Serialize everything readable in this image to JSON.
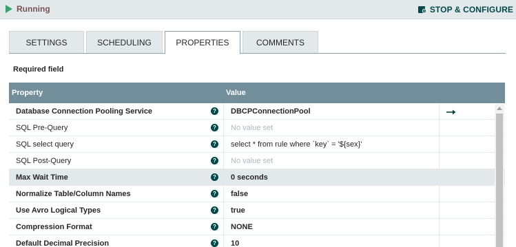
{
  "status": {
    "label": "Running",
    "color": "#3aa06e"
  },
  "header": {
    "stop_configure_label": "STOP & CONFIGURE"
  },
  "tabs": [
    {
      "label": "SETTINGS",
      "active": false
    },
    {
      "label": "SCHEDULING",
      "active": false
    },
    {
      "label": "PROPERTIES",
      "active": true
    },
    {
      "label": "COMMENTS",
      "active": false
    }
  ],
  "required_label": "Required field",
  "table": {
    "columns": {
      "property": "Property",
      "value": "Value"
    },
    "rows": [
      {
        "name": "Database Connection Pooling Service",
        "value": "DBCPConnectionPool",
        "required": true,
        "empty": false,
        "has_goto": true,
        "shaded": false
      },
      {
        "name": "SQL Pre-Query",
        "value": "No value set",
        "required": false,
        "empty": true,
        "has_goto": false,
        "shaded": false
      },
      {
        "name": "SQL select query",
        "value": "select * from rule where `key` = '${sex}'",
        "required": false,
        "empty": false,
        "has_goto": false,
        "shaded": false
      },
      {
        "name": "SQL Post-Query",
        "value": "No value set",
        "required": false,
        "empty": true,
        "has_goto": false,
        "shaded": false
      },
      {
        "name": "Max Wait Time",
        "value": "0 seconds",
        "required": true,
        "empty": false,
        "has_goto": false,
        "shaded": true
      },
      {
        "name": "Normalize Table/Column Names",
        "value": "false",
        "required": true,
        "empty": false,
        "has_goto": false,
        "shaded": false
      },
      {
        "name": "Use Avro Logical Types",
        "value": "true",
        "required": true,
        "empty": false,
        "has_goto": false,
        "shaded": false
      },
      {
        "name": "Compression Format",
        "value": "NONE",
        "required": true,
        "empty": false,
        "has_goto": false,
        "shaded": false
      },
      {
        "name": "Default Decimal Precision",
        "value": "10",
        "required": true,
        "empty": false,
        "has_goto": false,
        "shaded": false
      }
    ]
  },
  "colors": {
    "header_bg": "#728e9b",
    "accent": "#004849",
    "running_label": "#775351"
  },
  "icons": {
    "status": "play-icon",
    "stop": "stop-configure-icon",
    "help": "help-icon",
    "goto": "arrow-right-icon"
  }
}
